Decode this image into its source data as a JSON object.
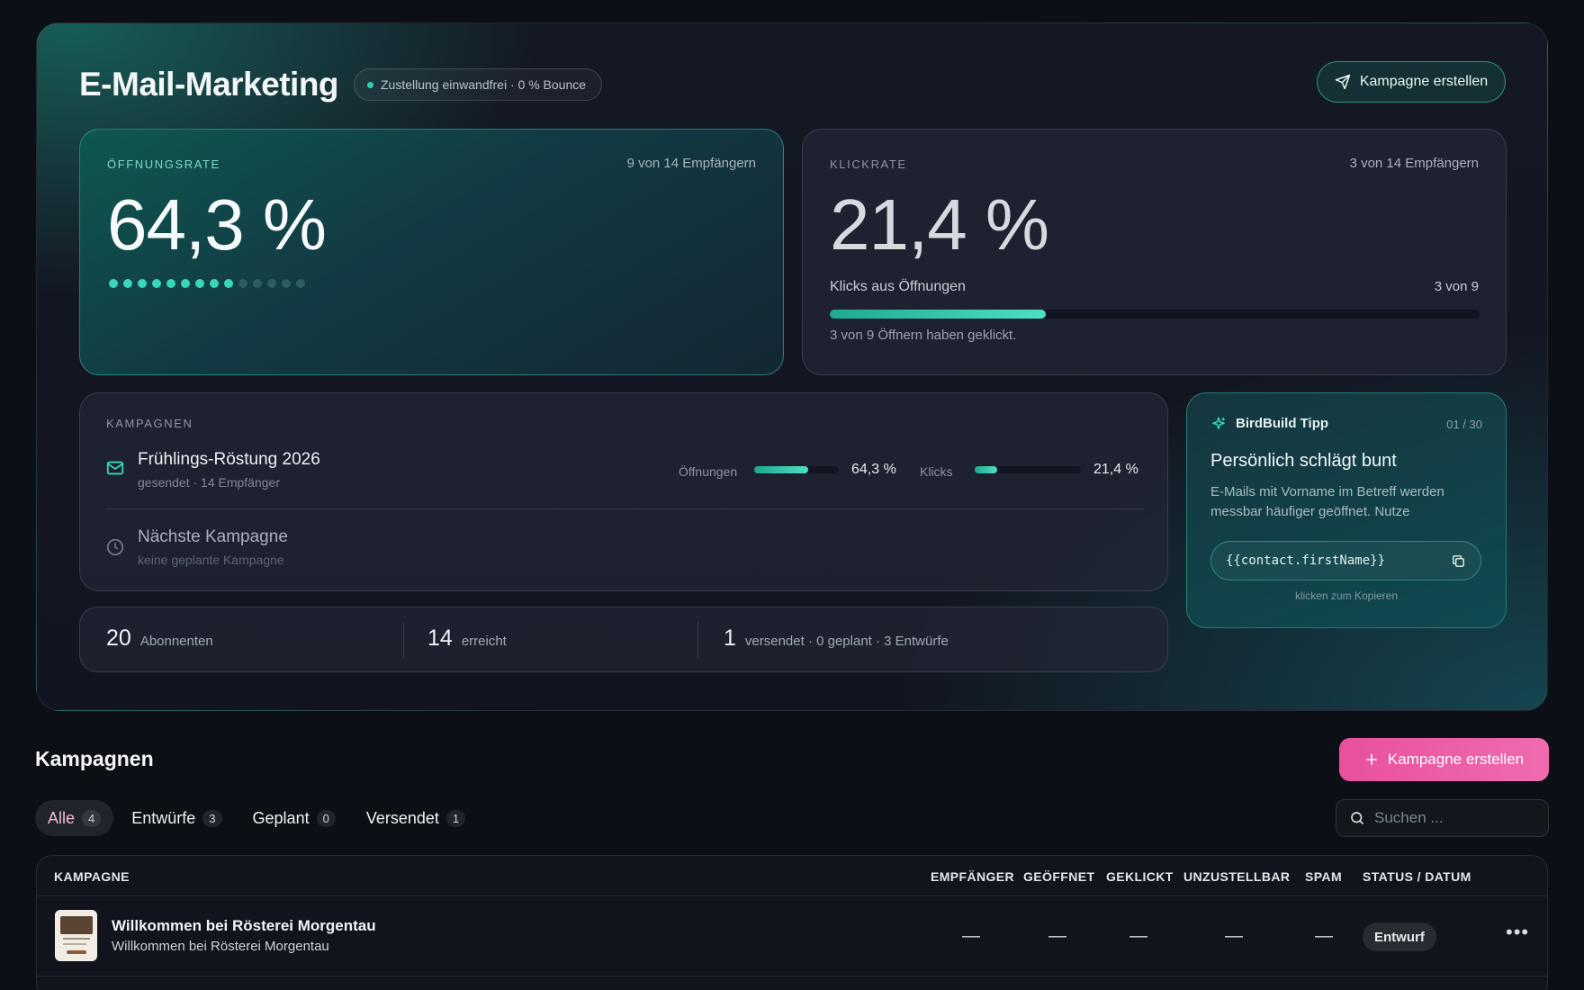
{
  "header": {
    "title": "E-Mail-Marketing",
    "status": "Zustellung einwandfrei · 0 % Bounce",
    "cta_label": "Kampagne erstellen"
  },
  "open_rate": {
    "label": "ÖFFNUNGSRATE",
    "value": "64,3 %",
    "detail": "9 von 14 Empfängern",
    "opened": 9,
    "total": 14
  },
  "click_rate": {
    "label": "KLICKRATE",
    "value": "21,4 %",
    "detail": "3 von 14 Empfängern",
    "bar_label": "Klicks aus Öffnungen",
    "bar_count": "3 von 9",
    "bar_fraction": 0.333,
    "note": "3 von 9 Öffnern haben geklickt."
  },
  "campaigns_card": {
    "label": "KAMPAGNEN",
    "current": {
      "name": "Frühlings-Röstung 2026",
      "sub": "gesendet · 14 Empfänger",
      "opens_label": "Öffnungen",
      "opens_value": "64,3 %",
      "opens_fraction": 0.643,
      "clicks_label": "Klicks",
      "clicks_value": "21,4 %",
      "clicks_fraction": 0.214
    },
    "next": {
      "name": "Nächste Kampagne",
      "sub": "keine geplante Kampagne"
    }
  },
  "stats": [
    {
      "num": "20",
      "label": "Abonnenten"
    },
    {
      "num": "14",
      "label": "erreicht"
    },
    {
      "num": "1",
      "label": "versendet · 0 geplant · 3 Entwürfe"
    }
  ],
  "tip": {
    "brand": "BirdBuild Tipp",
    "counter": "01 / 30",
    "title": "Persönlich schlägt bunt",
    "text": "E-Mails mit Vorname im Betreff werden messbar häufiger geöffnet. Nutze",
    "code": "{{contact.firstName}}",
    "hint": "klicken zum Kopieren"
  },
  "section": {
    "title": "Kampagnen",
    "cta_label": "Kampagne erstellen"
  },
  "tabs": [
    {
      "label": "Alle",
      "count": "4"
    },
    {
      "label": "Entwürfe",
      "count": "3"
    },
    {
      "label": "Geplant",
      "count": "0"
    },
    {
      "label": "Versendet",
      "count": "1"
    }
  ],
  "search": {
    "placeholder": "Suchen ..."
  },
  "table": {
    "columns": [
      "KAMPAGNE",
      "EMPFÄNGER",
      "GEÖFFNET",
      "GEKLICKT",
      "UNZUSTELLBAR",
      "SPAM",
      "STATUS / DATUM"
    ],
    "rows": [
      {
        "name": "Willkommen bei Rösterei Morgentau",
        "subject": "Willkommen bei Rösterei Morgentau",
        "recipients": "—",
        "opened": "—",
        "clicked": "—",
        "bounced": "—",
        "spam": "—",
        "status": "Entwurf"
      }
    ]
  },
  "colors": {
    "accent_teal": "#39d6bb",
    "accent_pink": "#e8509b",
    "background": "#0c0f16"
  }
}
